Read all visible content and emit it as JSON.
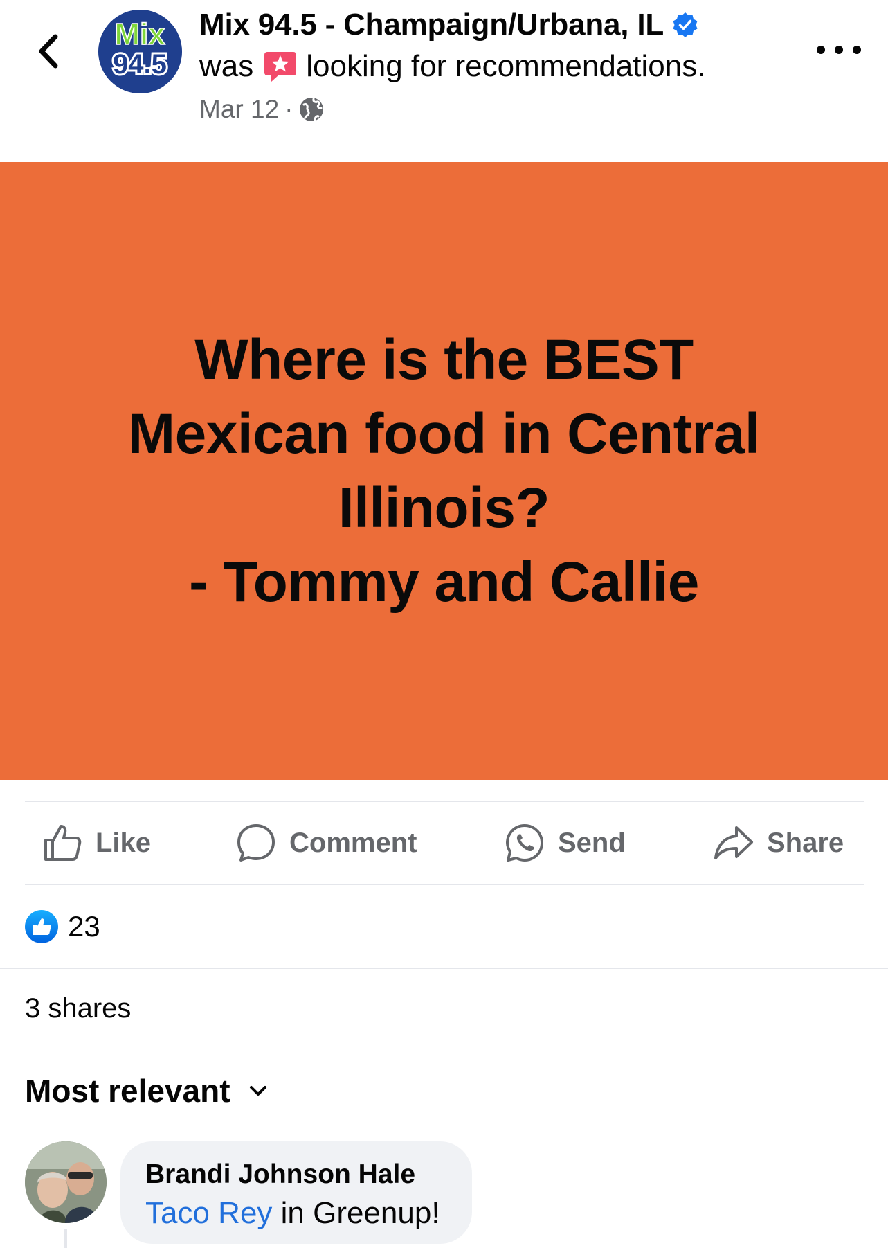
{
  "header": {
    "page_name": "Mix 94.5 - Champaign/Urbana, IL",
    "activity_prefix": "was",
    "activity_text": "looking for recommendations.",
    "date": "Mar 12",
    "meta_separator": "·",
    "logo_text": "Mix",
    "logo_number": "94.5"
  },
  "post": {
    "lines": [
      "Where is the BEST",
      "Mexican food in Central",
      "Illinois?",
      "- Tommy and Callie"
    ],
    "background_color": "#ec6d39"
  },
  "actions": {
    "like": "Like",
    "comment": "Comment",
    "send": "Send",
    "share": "Share"
  },
  "reactions": {
    "count": "23"
  },
  "shares_text": "3 shares",
  "sort_label": "Most relevant",
  "comment": {
    "author": "Brandi Johnson Hale",
    "link_text": "Taco Rey",
    "text": " in Greenup!"
  },
  "colors": {
    "facebook_blue": "#1877f2",
    "link_blue": "#216fdb",
    "secondary_text": "#65676b",
    "divider": "#e4e6eb"
  }
}
